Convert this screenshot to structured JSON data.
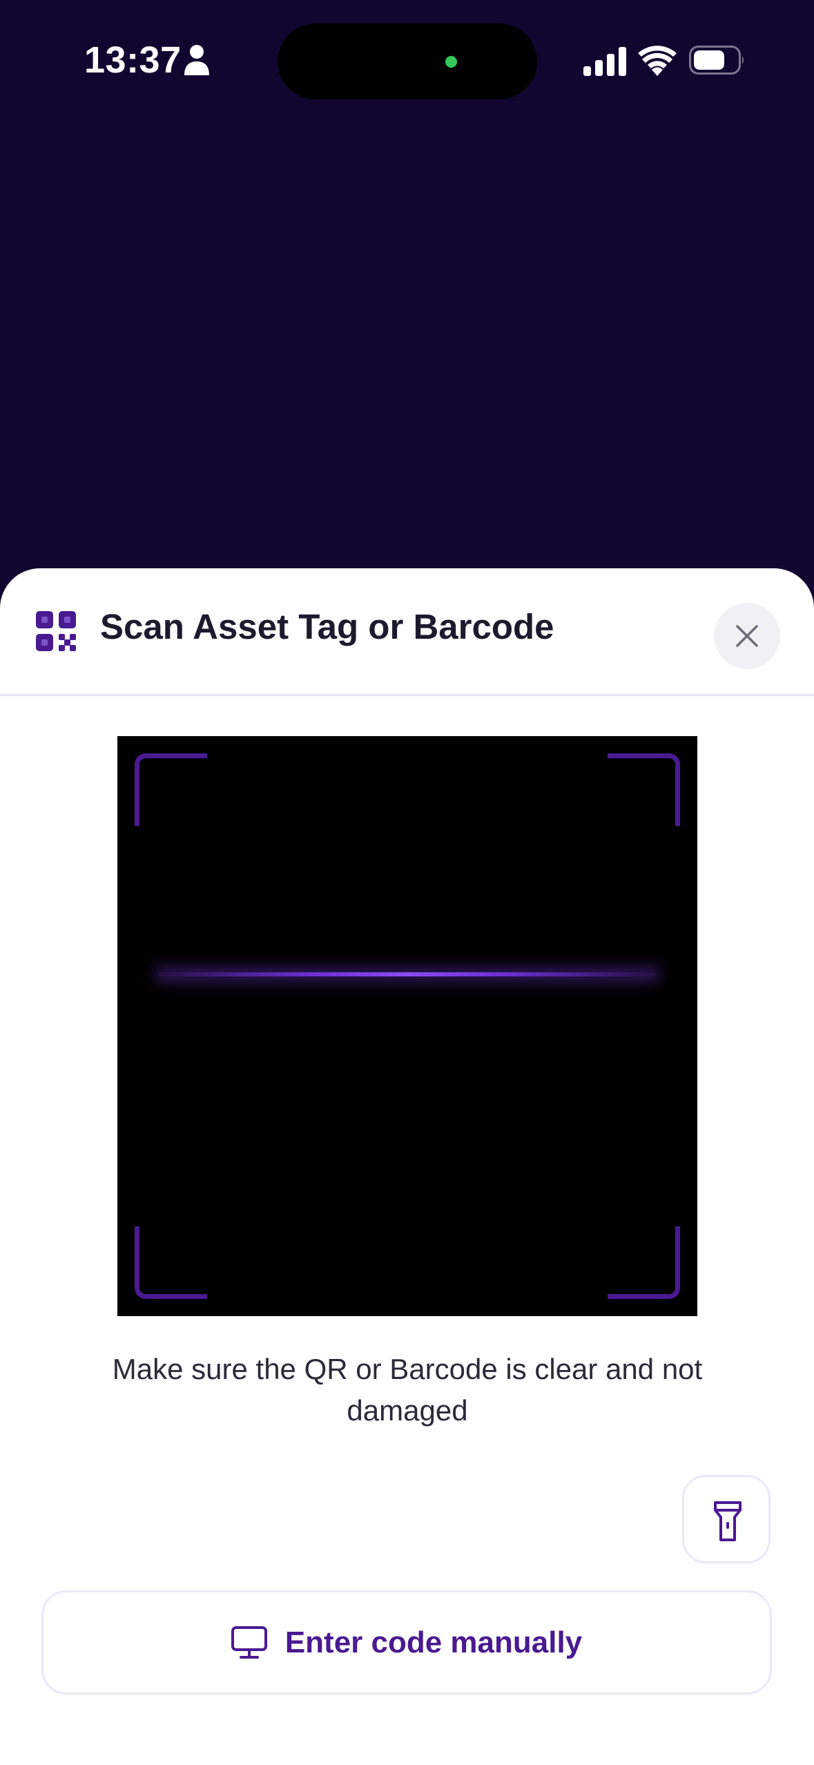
{
  "status_bar": {
    "time": "13:37",
    "icons": [
      "person-icon",
      "cellular-signal-icon",
      "wifi-icon",
      "battery-icon"
    ]
  },
  "sheet": {
    "title": "Scan Asset Tag or Barcode",
    "header_icon": "qr-code-icon",
    "close_icon": "close-icon"
  },
  "scanner": {
    "hint": "Make sure the QR or Barcode is clear and not damaged"
  },
  "actions": {
    "flashlight_icon": "flashlight-icon",
    "manual_entry_label": "Enter code manually",
    "manual_entry_icon": "monitor-icon"
  },
  "colors": {
    "background": "#100731",
    "accent": "#4a1a91",
    "scan_line": "#8a4cf0",
    "camera_indicator": "#34c759"
  }
}
